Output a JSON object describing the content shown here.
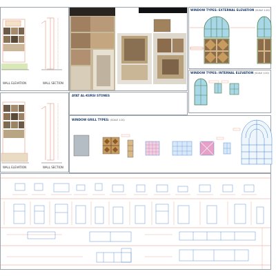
{
  "sheet": {
    "labels": {
      "wall_elevation_1": "WALL ELEVATION",
      "wall_section_1": "WALL SECTION",
      "wall_elevation_2": "WALL ELEVATION",
      "wall_section_2": "WALL SECTION",
      "ayat_title": "AYAT AL-KURSI STONES",
      "window_ext_title": "WINDOW TYPES: EXTERNAL ELEVATION",
      "window_ext_scale": "(SCALE 1:20)",
      "window_int_title": "WINDOW TYPES: INTERNAL ELEVATION",
      "window_int_scale": "(SCALE 1:20)",
      "grill_title": "WINDOW GRILL TYPES:",
      "grill_scale": "(SCALE 1:20)"
    },
    "colors": {
      "frame": "#9aa3ad",
      "heading": "#1a3a6a",
      "dim_line": "#e07a5f",
      "detail_line": "#3a7bd5",
      "wall_stone": "#8b7355",
      "glass": "#a8d8e8",
      "grill_tile": "#c89b5e",
      "grill_pink": "#e8a0c8",
      "grill_blue": "#6aa8d8"
    }
  }
}
